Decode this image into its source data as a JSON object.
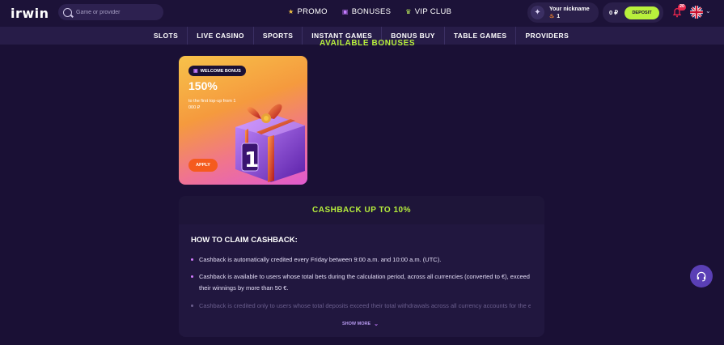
{
  "header": {
    "logo_text": "irwin",
    "search_placeholder": "Game or provider",
    "nav": [
      {
        "label": "PROMO",
        "icon": "star-icon"
      },
      {
        "label": "BONUSES",
        "icon": "gift-icon"
      },
      {
        "label": "VIP CLUB",
        "icon": "crown-icon"
      }
    ],
    "profile": {
      "nickname": "Your nickname",
      "level": "1"
    },
    "wallet": {
      "balance": "0 ₽",
      "deposit_label": "DEPOSIT"
    },
    "notifications_count": "20"
  },
  "categories": [
    "SLOTS",
    "LIVE CASINO",
    "SPORTS",
    "INSTANT GAMES",
    "BONUS BUY",
    "TABLE GAMES",
    "PROVIDERS"
  ],
  "section_title": "AVAILABLE BONUSES",
  "bonus_card": {
    "badge": "WELCOME BONUS",
    "percent": "150%",
    "subtitle": "to the first top-up from 1 000 ₽",
    "apply_label": "APPLY",
    "box_number": "1"
  },
  "cashback": {
    "title": "CASHBACK UP TO 10%",
    "heading": "HOW TO CLAIM CASHBACK:",
    "bullets": [
      "Cashback is automatically credited every Friday between 9:00 a.m. and 10:00 a.m. (UTC).",
      "Cashback is available to users whose total bets during the calculation period, across all currencies (converted to €), exceed their winnings by more than 50 €.",
      "Cashback is credited only to users whose total deposits exceed their total withdrawals across all currency accounts for the entire"
    ],
    "show_more": "SHOW MORE"
  },
  "colors": {
    "accent": "#b8f03c",
    "background": "#1a1035",
    "apply": "#f55b1e",
    "support": "#5a3fb5"
  }
}
